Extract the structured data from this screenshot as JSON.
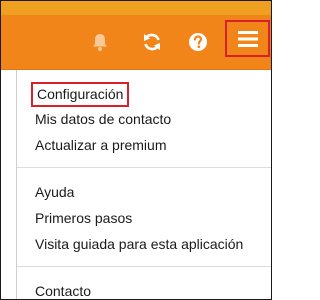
{
  "header": {
    "icons": [
      "bell-icon",
      "refresh-icon",
      "help-icon",
      "hamburger-menu-icon"
    ],
    "colors": {
      "bar": "#f28519",
      "top_strip": "#f0a020",
      "highlight_border": "#d8202a",
      "icon": "#ffffff"
    }
  },
  "menu": {
    "groups": [
      {
        "items": [
          "Configuración",
          "Mis datos de contacto",
          "Actualizar a premium"
        ]
      },
      {
        "items": [
          "Ayuda",
          "Primeros pasos",
          "Visita guiada para esta aplicación"
        ]
      },
      {
        "items": [
          "Contacto"
        ]
      }
    ],
    "highlighted_item": "Configuración"
  }
}
